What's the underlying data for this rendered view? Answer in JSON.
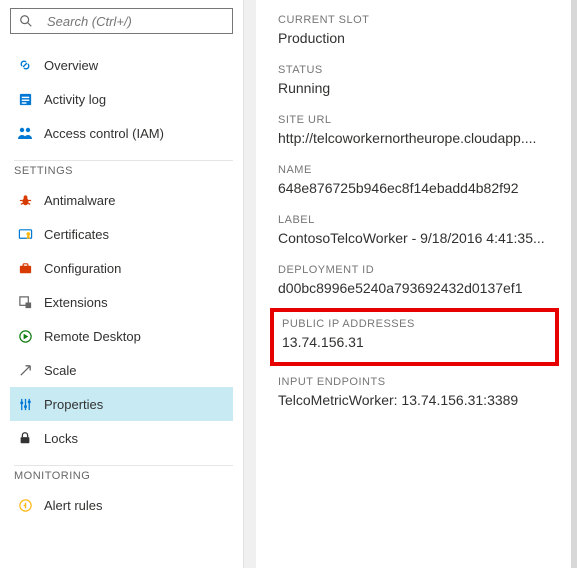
{
  "search": {
    "placeholder": "Search (Ctrl+/)"
  },
  "nav": {
    "top": [
      {
        "label": "Overview"
      },
      {
        "label": "Activity log"
      },
      {
        "label": "Access control (IAM)"
      }
    ],
    "sections": [
      {
        "header": "Settings",
        "items": [
          {
            "label": "Antimalware"
          },
          {
            "label": "Certificates"
          },
          {
            "label": "Configuration"
          },
          {
            "label": "Extensions"
          },
          {
            "label": "Remote Desktop"
          },
          {
            "label": "Scale"
          },
          {
            "label": "Properties",
            "selected": true
          },
          {
            "label": "Locks"
          }
        ]
      },
      {
        "header": "Monitoring",
        "items": [
          {
            "label": "Alert rules"
          }
        ]
      }
    ]
  },
  "details": {
    "current_slot": {
      "label": "Current Slot",
      "value": "Production"
    },
    "status": {
      "label": "Status",
      "value": "Running"
    },
    "site_url": {
      "label": "Site URL",
      "value": "http://telcoworkernortheurope.cloudapp...."
    },
    "name": {
      "label": "Name",
      "value": "648e876725b946ec8f14ebadd4b82f92"
    },
    "label_field": {
      "label": "Label",
      "value": "ContosoTelcoWorker - 9/18/2016 4:41:35..."
    },
    "deployment_id": {
      "label": "Deployment ID",
      "value": "d00bc8996e5240a793692432d0137ef1"
    },
    "public_ip": {
      "label": "Public IP Addresses",
      "value": "13.74.156.31"
    },
    "input_endpoints": {
      "label": "Input Endpoints",
      "value": "TelcoMetricWorker: 13.74.156.31:3389"
    }
  },
  "colors": {
    "accent": "#0078d4",
    "selected_bg": "#c7eaf3",
    "highlight": "#e60000"
  }
}
